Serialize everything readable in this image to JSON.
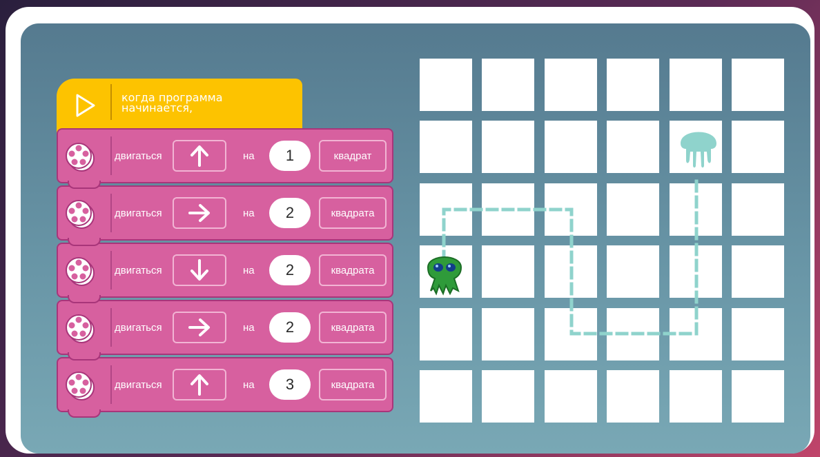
{
  "program": {
    "start_block": {
      "label": "когда программа начинается,",
      "icon": "play-icon",
      "color": "#fdc300"
    },
    "move_label": "двигаться",
    "on_label": "на",
    "blocks": [
      {
        "direction": "up",
        "arrow_icon": "arrow-up-icon",
        "steps": "1",
        "unit": "квадрат"
      },
      {
        "direction": "right",
        "arrow_icon": "arrow-right-icon",
        "steps": "2",
        "unit": "квадрата"
      },
      {
        "direction": "down",
        "arrow_icon": "arrow-down-icon",
        "steps": "2",
        "unit": "квадрата"
      },
      {
        "direction": "right",
        "arrow_icon": "arrow-right-icon",
        "steps": "2",
        "unit": "квадрата"
      },
      {
        "direction": "up",
        "arrow_icon": "arrow-up-icon",
        "steps": "3",
        "unit": "квадрата"
      }
    ],
    "block_color": "#d7609f",
    "block_icon": "motor-reel-icon"
  },
  "board": {
    "rows": 6,
    "columns": 6,
    "start": {
      "row": 4,
      "col": 1,
      "character": "green-octopus-icon",
      "color": "#2f9b3a"
    },
    "end": {
      "row": 2,
      "col": 5,
      "character": "jellyfish-icon",
      "color": "#8fd3cc"
    },
    "path_color": "#8fd3cc",
    "path_style": "dashed"
  }
}
